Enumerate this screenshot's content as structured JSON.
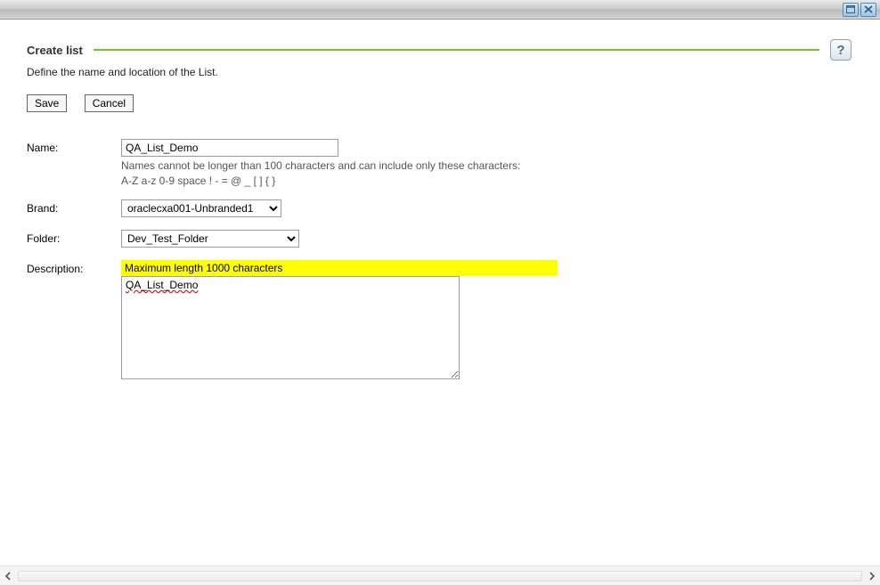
{
  "header": {
    "title": "Create list",
    "subtitle": "Define the name and location of the List."
  },
  "buttons": {
    "save": "Save",
    "cancel": "Cancel"
  },
  "labels": {
    "name": "Name:",
    "brand": "Brand:",
    "folder": "Folder:",
    "description": "Description:"
  },
  "fields": {
    "name_value": "QA_List_Demo",
    "name_hint1": "Names cannot be longer than 100 characters and can include only these characters:",
    "name_hint2": "A-Z a-z 0-9 space ! - = @ _ [ ] { }",
    "brand_value": "oraclecxa001-Unbranded1",
    "folder_value": "Dev_Test_Folder",
    "desc_highlight": "Maximum length 1000 characters",
    "desc_value": "QA_List_Demo"
  },
  "help_glyph": "?"
}
